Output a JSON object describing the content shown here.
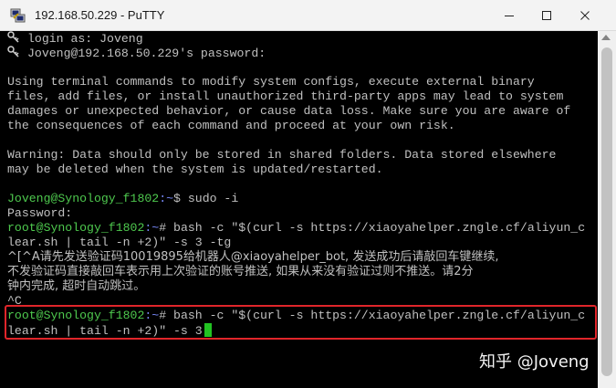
{
  "window": {
    "title": "192.168.50.229 - PuTTY",
    "icon": "putty-icon",
    "controls": {
      "minimize": "minimize-icon",
      "maximize": "maximize-icon",
      "close": "close-icon"
    }
  },
  "terminal": {
    "login_line": "login as: Joveng",
    "password_prompt": "Joveng@192.168.50.229's password:",
    "warning_paragraph": [
      "Using terminal commands to modify system configs, execute external binary",
      "files, add files, or install unauthorized third-party apps may lead to system",
      "damages or unexpected behavior, or cause data loss. Make sure you are aware of",
      "the consequences of each command and proceed at your own risk."
    ],
    "data_warning": [
      "Warning: Data should only be stored in shared folders. Data stored elsewhere",
      "may be deleted when the system is updated/restarted."
    ],
    "prompt1": {
      "user": "Joveng@Synology_f1802",
      "path": ":~",
      "symbol": "$",
      "command": " sudo -i"
    },
    "password_line": "Password:",
    "prompt2": {
      "user": "root@Synology_f1802",
      "path": ":~",
      "symbol": "#",
      "command": " bash -c \"$(curl -s https://xiaoyahelper.zngle.cf/aliyun_c",
      "command_cont": "lear.sh | tail -n +2)\" -s 3 -tg"
    },
    "output_lines": [
      "^[^A请先发送验证码10019895给机器人@xiaoyahelper_bot, 发送成功后请敲回车键继续,",
      "不发验证码直接敲回车表示用上次验证的账号推送, 如果从来没有验证过则不推送。请2分",
      "钟内完成, 超时自动跳过。",
      "^C"
    ],
    "prompt3": {
      "user": "root@Synology_f1802",
      "path": ":~",
      "symbol": "#",
      "command": " bash -c \"$(curl -s https://xiaoyahelper.zngle.cf/aliyun_c",
      "command_cont": "lear.sh | tail -n +2)\" -s 3"
    }
  },
  "watermark": "知乎 @Joveng",
  "colors": {
    "terminal_bg": "#000000",
    "text": "#c0c0c0",
    "prompt_user": "#4ec94e",
    "prompt_path": "#7a8cff",
    "cursor": "#22c322",
    "highlight_border": "#e0252a"
  }
}
